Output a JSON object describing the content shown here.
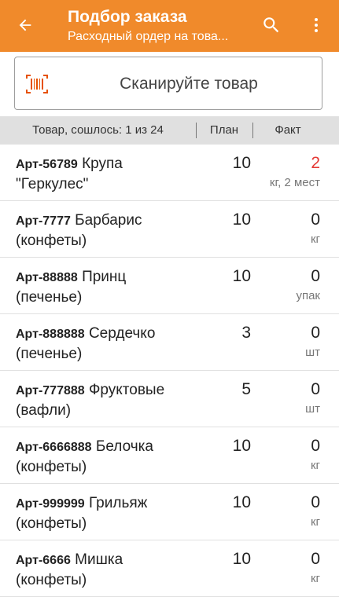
{
  "appbar": {
    "title": "Подбор заказа",
    "subtitle": "Расходный ордер на това...",
    "back_icon": "arrow-left-icon",
    "search_icon": "search-icon",
    "more_icon": "more-vert-icon",
    "color": "#f08a2b"
  },
  "scan": {
    "label": "Сканируйте товар",
    "icon": "barcode-icon",
    "icon_color": "#e65100"
  },
  "table": {
    "header_product": "Товар, сошлось: 1 из 24",
    "header_plan": "План",
    "header_fact": "Факт"
  },
  "items": [
    {
      "art": "Арт-56789",
      "name_1": "Крупа",
      "name_2": "\"Геркулес\"",
      "plan": "10",
      "fact": "2",
      "unit": "кг, 2 мест",
      "fact_color": "#e53935"
    },
    {
      "art": "Арт-7777",
      "name_1": "Барбарис",
      "name_2": "(конфеты)",
      "plan": "10",
      "fact": "0",
      "unit": "кг"
    },
    {
      "art": "Арт-88888",
      "name_1": "Принц",
      "name_2": "(печенье)",
      "plan": "10",
      "fact": "0",
      "unit": "упак"
    },
    {
      "art": "Арт-888888",
      "name_1": "Сердечко",
      "name_2": "(печенье)",
      "plan": "3",
      "fact": "0",
      "unit": "шт"
    },
    {
      "art": "Арт-777888",
      "name_1": "Фруктовые",
      "name_2": "(вафли)",
      "plan": "5",
      "fact": "0",
      "unit": "шт"
    },
    {
      "art": "Арт-6666888",
      "name_1": "Белочка",
      "name_2": "(конфеты)",
      "plan": "10",
      "fact": "0",
      "unit": "кг"
    },
    {
      "art": "Арт-999999",
      "name_1": "Грильяж",
      "name_2": "(конфеты)",
      "plan": "10",
      "fact": "0",
      "unit": "кг"
    },
    {
      "art": "Арт-6666",
      "name_1": "Мишка",
      "name_2": "(конфеты)",
      "plan": "10",
      "fact": "0",
      "unit": "кг"
    }
  ]
}
